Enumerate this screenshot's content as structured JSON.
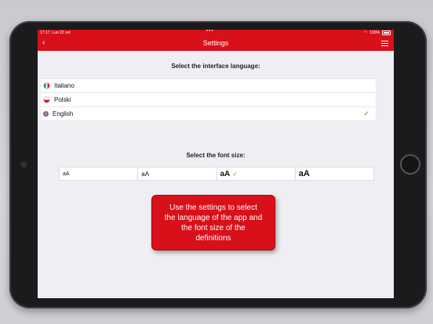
{
  "status_bar": {
    "time": "17:17",
    "date": "Lun 22 set",
    "battery": "100%"
  },
  "navbar": {
    "title": "Settings"
  },
  "language_section": {
    "title": "Select the interface language:",
    "languages": [
      {
        "label": "Italiano",
        "flag": "italy-flag-icon",
        "selected": false
      },
      {
        "label": "Polski",
        "flag": "poland-flag-icon",
        "selected": false
      },
      {
        "label": "English",
        "flag": "uk-flag-icon",
        "selected": true
      }
    ],
    "check_symbol": "✓"
  },
  "font_section": {
    "title": "Select the font size:",
    "options": [
      {
        "label": "aA",
        "selected": false
      },
      {
        "label": "aA",
        "selected": false
      },
      {
        "label": "aA",
        "selected": true
      },
      {
        "label": "aA",
        "selected": false
      }
    ],
    "check_symbol": "✓"
  },
  "tooltip": {
    "text": "Use the settings to select the language of the app and the font size of the definitions"
  },
  "colors": {
    "accent": "#d8101a",
    "check": "#3aa845",
    "background": "#efeff3"
  }
}
